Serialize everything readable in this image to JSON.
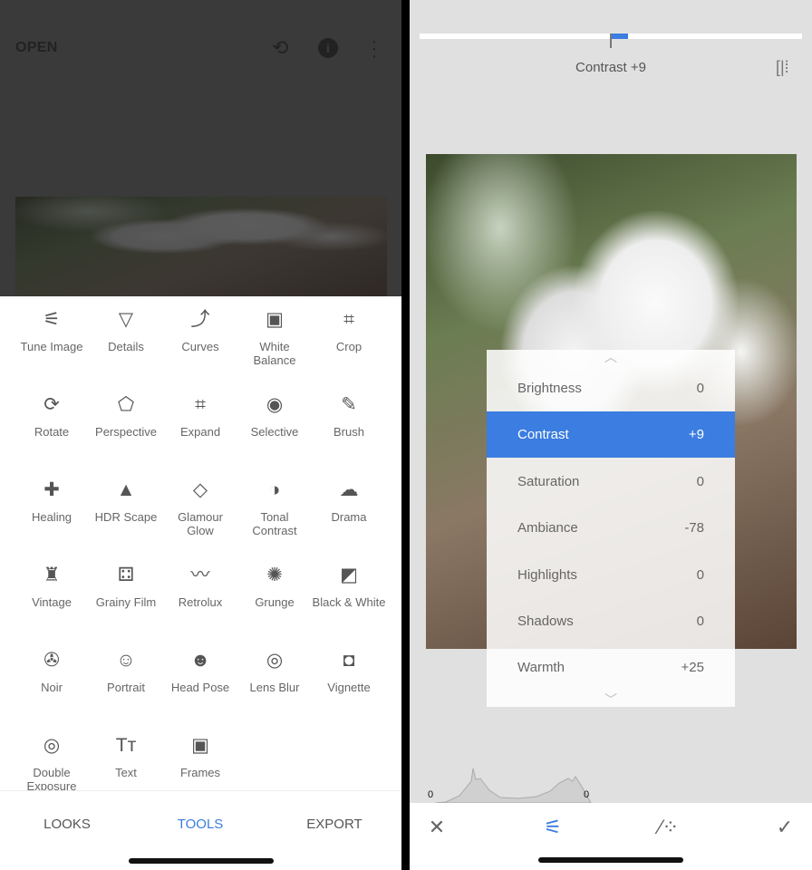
{
  "left": {
    "header": {
      "open_label": "OPEN",
      "icons": [
        "undo-layers-icon",
        "info-icon",
        "more-vert-icon"
      ]
    },
    "tools": [
      {
        "label": "Tune Image",
        "icon": "⚟"
      },
      {
        "label": "Details",
        "icon": "▽"
      },
      {
        "label": "Curves",
        "icon": "⤴"
      },
      {
        "label": "White Balance",
        "icon": "▣"
      },
      {
        "label": "Crop",
        "icon": "⌗"
      },
      {
        "label": "Rotate",
        "icon": "⟳"
      },
      {
        "label": "Perspective",
        "icon": "⬠"
      },
      {
        "label": "Expand",
        "icon": "⌗"
      },
      {
        "label": "Selective",
        "icon": "◉"
      },
      {
        "label": "Brush",
        "icon": "✎"
      },
      {
        "label": "Healing",
        "icon": "✚"
      },
      {
        "label": "HDR Scape",
        "icon": "▲"
      },
      {
        "label": "Glamour Glow",
        "icon": "◇"
      },
      {
        "label": "Tonal Contrast",
        "icon": "◑"
      },
      {
        "label": "Drama",
        "icon": "☁"
      },
      {
        "label": "Vintage",
        "icon": "♜"
      },
      {
        "label": "Grainy Film",
        "icon": "⚃"
      },
      {
        "label": "Retrolux",
        "icon": "〰"
      },
      {
        "label": "Grunge",
        "icon": "✺"
      },
      {
        "label": "Black & White",
        "icon": "◩"
      },
      {
        "label": "Noir",
        "icon": "✇"
      },
      {
        "label": "Portrait",
        "icon": "☺"
      },
      {
        "label": "Head Pose",
        "icon": "☻"
      },
      {
        "label": "Lens Blur",
        "icon": "◎"
      },
      {
        "label": "Vignette",
        "icon": "◘"
      },
      {
        "label": "Double Exposure",
        "icon": "◎"
      },
      {
        "label": "Text",
        "icon": "Tт"
      },
      {
        "label": "Frames",
        "icon": "▣"
      }
    ],
    "nav": {
      "looks": "LOOKS",
      "tools": "TOOLS",
      "export": "EXPORT"
    }
  },
  "right": {
    "status_label": "Contrast +9",
    "slider_value": 9,
    "adjustments": [
      {
        "label": "Brightness",
        "value": "0"
      },
      {
        "label": "Contrast",
        "value": "+9",
        "selected": true
      },
      {
        "label": "Saturation",
        "value": "0"
      },
      {
        "label": "Ambiance",
        "value": "-78"
      },
      {
        "label": "Highlights",
        "value": "0"
      },
      {
        "label": "Shadows",
        "value": "0"
      },
      {
        "label": "Warmth",
        "value": "+25"
      }
    ],
    "histogram": {
      "left_clip": "0",
      "right_clip": "0"
    },
    "bottom_icons": [
      "close-icon",
      "tune-icon",
      "magic-wand-icon",
      "check-icon"
    ]
  },
  "colors": {
    "accent": "#3b7de0"
  }
}
